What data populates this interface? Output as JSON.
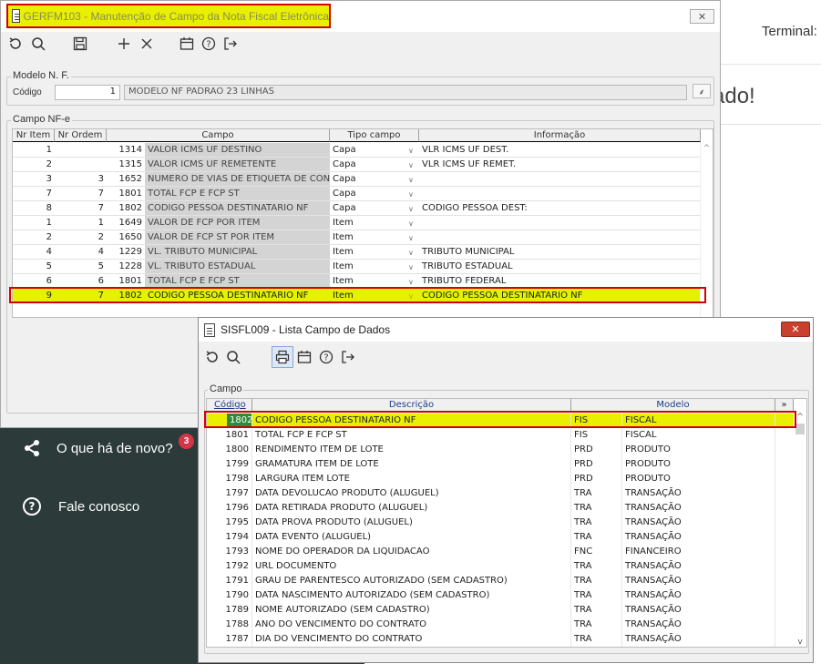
{
  "background": {
    "terminal_label": "Terminal:",
    "big_text": "ado!",
    "dark_panel": {
      "items": [
        {
          "icon": "share-icon",
          "label": "O que há de novo?"
        },
        {
          "icon": "help-icon",
          "label": "Fale conosco"
        }
      ],
      "badge_count": "3"
    }
  },
  "window1": {
    "title": "GERFM103 - Manutenção de Campo da Nota Fiscal Eletrônica",
    "close_label": "✕",
    "toolbar": [
      "refresh-icon",
      "search-icon",
      "save-icon",
      "add-icon",
      "delete-icon",
      "calendar-icon",
      "help-icon",
      "exit-icon"
    ],
    "modelo": {
      "group_label": "Modelo N. F.",
      "codigo_label": "Código",
      "codigo_value": "1",
      "descricao_value": "MODELO NF PADRAO 23 LINHAS"
    },
    "campo_group_label": "Campo NF-e",
    "columns": [
      "Nr Item",
      "Nr Ordem",
      "Campo",
      "Tipo campo",
      "Informação"
    ],
    "rows": [
      {
        "item": "1",
        "ordem": "",
        "code": "1314",
        "campo": "VALOR ICMS UF DESTINO",
        "tipo": "Capa",
        "info": "VLR ICMS UF DEST."
      },
      {
        "item": "2",
        "ordem": "",
        "code": "1315",
        "campo": "VALOR ICMS UF REMETENTE",
        "tipo": "Capa",
        "info": "VLR ICMS UF REMET."
      },
      {
        "item": "3",
        "ordem": "3",
        "code": "1652",
        "campo": "NUMERO DE VIAS DE ETIQUETA DE CONT",
        "tipo": "Capa",
        "info": ""
      },
      {
        "item": "7",
        "ordem": "7",
        "code": "1801",
        "campo": "TOTAL FCP E FCP ST",
        "tipo": "Capa",
        "info": ""
      },
      {
        "item": "8",
        "ordem": "7",
        "code": "1802",
        "campo": "CODIGO PESSOA DESTINATARIO NF",
        "tipo": "Capa",
        "info": "CODIGO PESSOA DEST:"
      },
      {
        "item": "1",
        "ordem": "1",
        "code": "1649",
        "campo": "VALOR DE FCP POR ITEM",
        "tipo": "Item",
        "info": ""
      },
      {
        "item": "2",
        "ordem": "2",
        "code": "1650",
        "campo": "VALOR DE FCP ST POR ITEM",
        "tipo": "Item",
        "info": ""
      },
      {
        "item": "4",
        "ordem": "4",
        "code": "1229",
        "campo": "VL. TRIBUTO MUNICIPAL",
        "tipo": "Item",
        "info": "TRIBUTO MUNICIPAL"
      },
      {
        "item": "5",
        "ordem": "5",
        "code": "1228",
        "campo": "VL. TRIBUTO ESTADUAL",
        "tipo": "Item",
        "info": "TRIBUTO ESTADUAL"
      },
      {
        "item": "6",
        "ordem": "6",
        "code": "1801",
        "campo": "TOTAL FCP E FCP ST",
        "tipo": "Item",
        "info": "TRIBUTO FEDERAL"
      },
      {
        "item": "9",
        "ordem": "7",
        "code": "1802",
        "campo": "CODIGO PESSOA DESTINATARIO NF",
        "tipo": "Item",
        "info": "CODIGO PESSOA DESTINATARIO NF"
      }
    ]
  },
  "window2": {
    "title": "SISFL009 - Lista Campo de Dados",
    "close_label": "✕",
    "group_label": "Campo",
    "columns": [
      "Código",
      "Descrição",
      "Modelo",
      "»"
    ],
    "rows": [
      {
        "codigo": "1802",
        "descricao": "CODIGO PESSOA DESTINATARIO NF",
        "sigla": "FIS",
        "modelo": "FISCAL"
      },
      {
        "codigo": "1801",
        "descricao": "TOTAL FCP E FCP ST",
        "sigla": "FIS",
        "modelo": "FISCAL"
      },
      {
        "codigo": "1800",
        "descricao": "RENDIMENTO ITEM DE LOTE",
        "sigla": "PRD",
        "modelo": "PRODUTO"
      },
      {
        "codigo": "1799",
        "descricao": "GRAMATURA ITEM DE LOTE",
        "sigla": "PRD",
        "modelo": "PRODUTO"
      },
      {
        "codigo": "1798",
        "descricao": "LARGURA ITEM LOTE",
        "sigla": "PRD",
        "modelo": "PRODUTO"
      },
      {
        "codigo": "1797",
        "descricao": "DATA DEVOLUCAO PRODUTO (ALUGUEL)",
        "sigla": "TRA",
        "modelo": "TRANSAÇÃO"
      },
      {
        "codigo": "1796",
        "descricao": "DATA RETIRADA PRODUTO (ALUGUEL)",
        "sigla": "TRA",
        "modelo": "TRANSAÇÃO"
      },
      {
        "codigo": "1795",
        "descricao": "DATA PROVA PRODUTO (ALUGUEL)",
        "sigla": "TRA",
        "modelo": "TRANSAÇÃO"
      },
      {
        "codigo": "1794",
        "descricao": "DATA EVENTO (ALUGUEL)",
        "sigla": "TRA",
        "modelo": "TRANSAÇÃO"
      },
      {
        "codigo": "1793",
        "descricao": "NOME DO OPERADOR DA LIQUIDACAO",
        "sigla": "FNC",
        "modelo": "FINANCEIRO"
      },
      {
        "codigo": "1792",
        "descricao": "URL DOCUMENTO",
        "sigla": "TRA",
        "modelo": "TRANSAÇÃO"
      },
      {
        "codigo": "1791",
        "descricao": "GRAU DE PARENTESCO AUTORIZADO (SEM CADASTRO)",
        "sigla": "TRA",
        "modelo": "TRANSAÇÃO"
      },
      {
        "codigo": "1790",
        "descricao": "DATA NASCIMENTO AUTORIZADO (SEM CADASTRO)",
        "sigla": "TRA",
        "modelo": "TRANSAÇÃO"
      },
      {
        "codigo": "1789",
        "descricao": "NOME AUTORIZADO (SEM CADASTRO)",
        "sigla": "TRA",
        "modelo": "TRANSAÇÃO"
      },
      {
        "codigo": "1788",
        "descricao": "ANO DO VENCIMENTO DO CONTRATO",
        "sigla": "TRA",
        "modelo": "TRANSAÇÃO"
      },
      {
        "codigo": "1787",
        "descricao": "DIA DO VENCIMENTO DO CONTRATO",
        "sigla": "TRA",
        "modelo": "TRANSAÇÃO"
      }
    ]
  },
  "colors": {
    "highlight_yellow": "#e8f000",
    "highlight_border": "#d40000",
    "dark_panel": "#2c3a3a",
    "badge": "#d63447",
    "close_red": "#c9402e"
  }
}
